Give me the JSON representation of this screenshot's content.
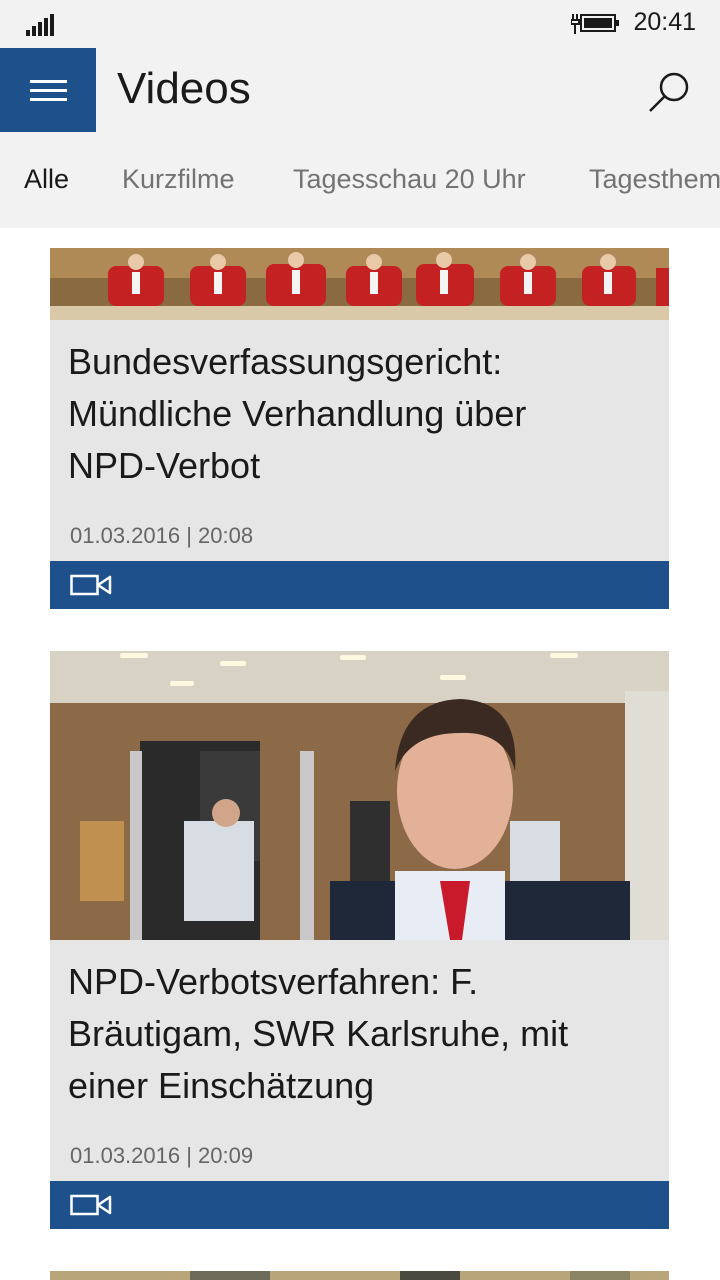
{
  "status": {
    "time": "20:41"
  },
  "header": {
    "title": "Videos"
  },
  "tabs": [
    {
      "label": "Alle",
      "active": true
    },
    {
      "label": "Kurzfilme",
      "active": false
    },
    {
      "label": "Tagesschau 20 Uhr",
      "active": false
    },
    {
      "label": "Tagesthemen",
      "active": false
    }
  ],
  "items": [
    {
      "title_lines": [
        "Bundesverfassungsgericht:",
        "Mündliche Verhandlung über",
        "NPD-Verbot"
      ],
      "date": "01.03.2016 | 20:08"
    },
    {
      "title_lines": [
        "NPD-Verbotsverfahren: F.",
        "Bräutigam, SWR Karlsruhe, mit",
        "einer Einschätzung"
      ],
      "date": "01.03.2016 | 20:09"
    }
  ],
  "colors": {
    "accent": "#1e518c",
    "header_bg": "#f2f2f2",
    "card_bg": "#e6e6e6"
  }
}
